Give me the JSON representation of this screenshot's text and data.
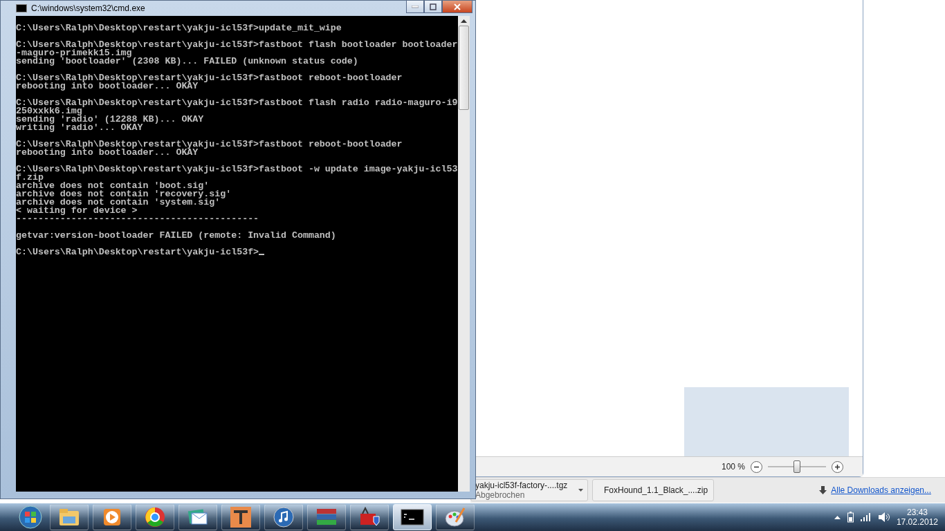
{
  "console_window": {
    "title": "C:\\windows\\system32\\cmd.exe",
    "blocks": [
      [
        "C:\\Users\\Ralph\\Desktop\\restart\\yakju-icl53f>update_mit_wipe"
      ],
      [
        "C:\\Users\\Ralph\\Desktop\\restart\\yakju-icl53f>fastboot flash bootloader bootloader",
        "-maguro-primekk15.img",
        "sending 'bootloader' (2308 KB)... FAILED (unknown status code)"
      ],
      [
        "C:\\Users\\Ralph\\Desktop\\restart\\yakju-icl53f>fastboot reboot-bootloader",
        "rebooting into bootloader... OKAY"
      ],
      [
        "C:\\Users\\Ralph\\Desktop\\restart\\yakju-icl53f>fastboot flash radio radio-maguro-i9",
        "250xxkk6.img",
        "sending 'radio' (12288 KB)... OKAY",
        "writing 'radio'... OKAY"
      ],
      [
        "C:\\Users\\Ralph\\Desktop\\restart\\yakju-icl53f>fastboot reboot-bootloader",
        "rebooting into bootloader... OKAY"
      ],
      [
        "C:\\Users\\Ralph\\Desktop\\restart\\yakju-icl53f>fastboot -w update image-yakju-icl53",
        "f.zip",
        "archive does not contain 'boot.sig'",
        "archive does not contain 'recovery.sig'",
        "archive does not contain 'system.sig'",
        "< waiting for device >",
        "--------------------------------------------"
      ],
      [
        "getvar:version-bootloader FAILED (remote: Invalid Command)"
      ],
      [
        "C:\\Users\\Ralph\\Desktop\\restart\\yakju-icl53f>"
      ]
    ]
  },
  "browser_window": {
    "zoom_reading": "100 %",
    "zoom_slider": {
      "level": 0.5
    }
  },
  "downloads_bar": {
    "items": [
      {
        "name": "yakju-icl53f-factory-....tgz",
        "status": "Abgebrochen"
      },
      {
        "name": "FoxHound_1.1_Black_....zip"
      }
    ],
    "show_all_link": "Alle Downloads anzeigen..."
  },
  "taskbar": {
    "items": [
      {
        "kind": "start",
        "selected": false
      },
      {
        "kind": "folder",
        "selected": false
      },
      {
        "kind": "player",
        "selected": false
      },
      {
        "kind": "browser",
        "selected": false
      },
      {
        "kind": "mail",
        "selected": false
      },
      {
        "kind": "letter",
        "selected": false
      },
      {
        "kind": "music",
        "selected": false
      },
      {
        "kind": "archive",
        "selected": false
      },
      {
        "kind": "toolbox",
        "selected": false
      },
      {
        "kind": "console",
        "selected": true
      },
      {
        "kind": "paint",
        "selected": false
      }
    ],
    "clock": {
      "time": "23:43",
      "date": "17.02.2012"
    }
  }
}
